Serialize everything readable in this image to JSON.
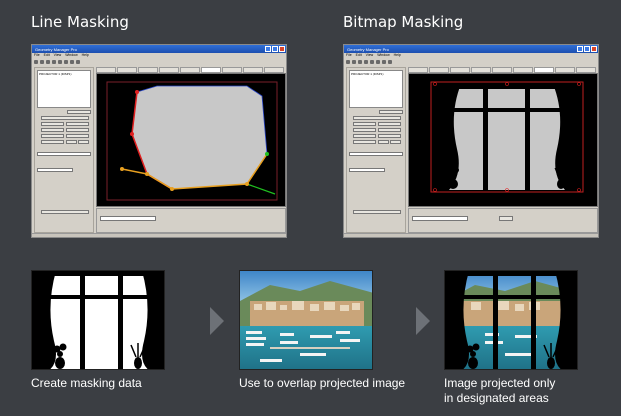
{
  "headings": {
    "line": "Line Masking",
    "bitmap": "Bitmap Masking"
  },
  "app": {
    "window_title": "Geometry Manager Pro",
    "menu": [
      "File",
      "Edit",
      "View",
      "Window",
      "Help"
    ],
    "tree_label": "PROJECTOR 1 (DISP1)",
    "tabs": [
      "Lens Setting",
      "Geometry",
      "Edge Blending",
      "Uniformity",
      "Brightness Control",
      "Line Masking",
      "Masking",
      "Black Space",
      "Other"
    ],
    "left_line_masking": {
      "buttons": [
        "Review",
        "Display Projector Name",
        "Screen ON",
        "Standby",
        "Shutter ON",
        "Shutter OFF",
        "Battery ON",
        "Battery OFF",
        "Battery Shift",
        "Pixel",
        "PICT"
      ],
      "test_pattern_label": "Test Pattern",
      "test_pattern_value": "OFF",
      "grid_resolution_label": "Grid Resolution",
      "display_grid_label": "Display Grid Lines",
      "mask_label": "Line Masking Information",
      "mask_items": [
        "None",
        "Internal",
        "Pattern"
      ],
      "transfer_label": "Transfer",
      "manual_transfer": "Manual Transfer",
      "auto_transfer": "Auto Transfer"
    },
    "bottom": {
      "mode_label": "Masking Form",
      "line_mode_value": "Line Masking",
      "bitmap_mode_value": "Bitmap Masking",
      "line_checks": [
        "Left",
        "Upper",
        "Right",
        "Lower",
        "Invert"
      ],
      "file_button": "File",
      "invert_label": "Invert",
      "status": "1.0 N"
    }
  },
  "captions": {
    "step1": "Create masking data",
    "step2": "Use to overlap projected image",
    "step3_line1": "Image projected only",
    "step3_line2": "in designated areas"
  },
  "colors": {
    "background": "#3b3e43",
    "arrow": "#6d7177",
    "title_bar": "#2358c4",
    "mask_fill": "#c8c8c8",
    "mask_edge_line": "#e8a020",
    "mask_point": "#e02020"
  },
  "icons": [
    "minimize-icon",
    "maximize-icon",
    "close-icon",
    "arrow-right-icon",
    "vase-icon",
    "curtain-icon"
  ]
}
